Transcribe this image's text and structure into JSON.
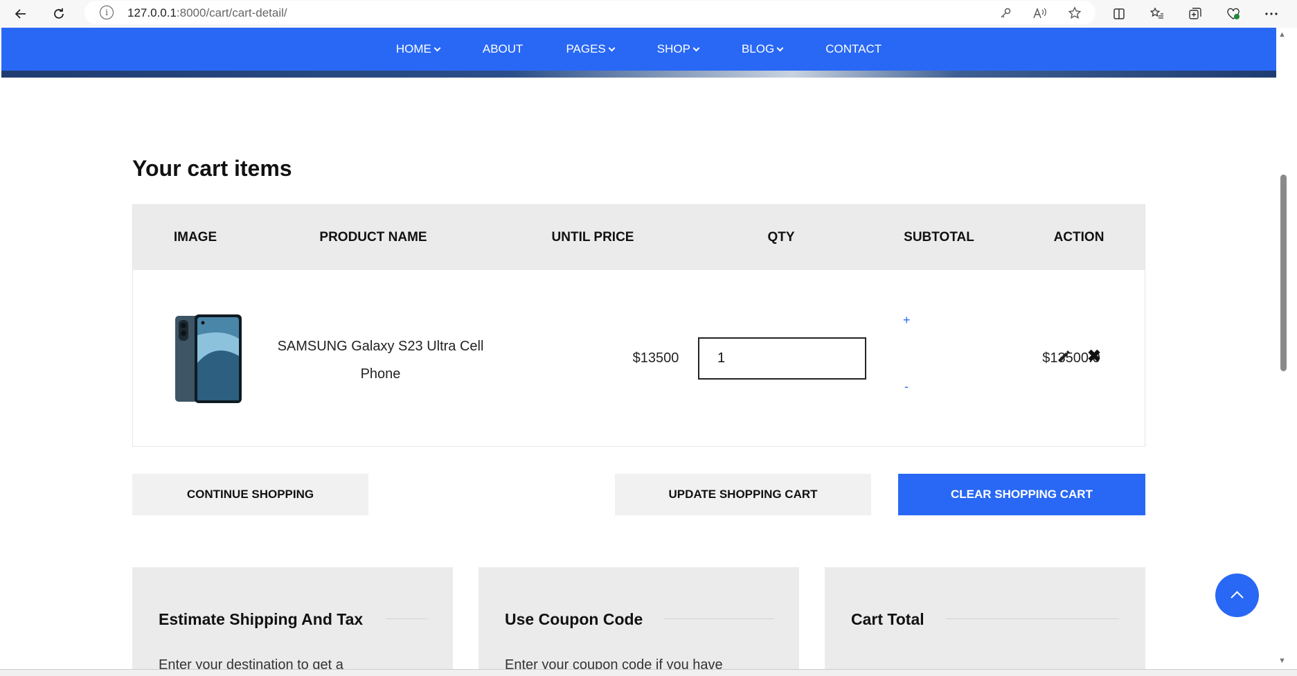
{
  "browser": {
    "url_host": "127.0.0.1",
    "url_path": ":8000/cart/cart-detail/",
    "info_glyph": "i"
  },
  "nav": {
    "items": [
      {
        "label": "HOME",
        "dropdown": true
      },
      {
        "label": "ABOUT",
        "dropdown": false
      },
      {
        "label": "PAGES",
        "dropdown": true
      },
      {
        "label": "SHOP",
        "dropdown": true
      },
      {
        "label": "BLOG",
        "dropdown": true
      },
      {
        "label": "CONTACT",
        "dropdown": false
      }
    ]
  },
  "cart": {
    "title": "Your cart items",
    "headers": {
      "image": "IMAGE",
      "product_name": "PRODUCT NAME",
      "unit_price": "UNTIL PRICE",
      "qty": "QTY",
      "subtotal": "SUBTOTAL",
      "action": "ACTION"
    },
    "items": [
      {
        "name": "SAMSUNG Galaxy S23 Ultra Cell Phone",
        "price": "$13500",
        "qty": "1",
        "subtotal": "$13500.0",
        "plus": "+",
        "minus": "-",
        "remove": "✖"
      }
    ]
  },
  "buttons": {
    "continue": "CONTINUE SHOPPING",
    "update": "UPDATE SHOPPING CART",
    "clear": "CLEAR SHOPPING CART"
  },
  "panels": {
    "shipping": {
      "title": "Estimate Shipping And Tax",
      "text": "Enter your destination to get a"
    },
    "coupon": {
      "title": "Use Coupon Code",
      "text": "Enter your coupon code if you have"
    },
    "total": {
      "title": "Cart Total",
      "text": ""
    }
  },
  "colors": {
    "accent": "#2968f5",
    "header_bg": "#ebebeb",
    "button_bg": "#f1f1f1"
  }
}
